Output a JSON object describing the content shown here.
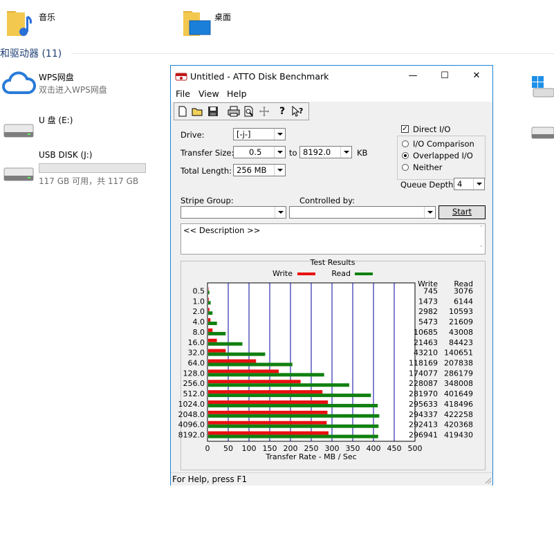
{
  "explorer": {
    "folders": [
      {
        "label": "音乐",
        "icon": "music-folder-icon"
      },
      {
        "label": "桌面",
        "icon": "desktop-folder-icon"
      }
    ],
    "section_title": "和驱动器 (11)",
    "drives": [
      {
        "name": "WPS网盘",
        "sub": "双击进入WPS网盘",
        "icon": "wps-cloud-icon"
      },
      {
        "name": "U 盘 (E:)",
        "sub": "",
        "icon": "usb-drive-icon"
      },
      {
        "name": "USB DISK (J:)",
        "sub": "117 GB 可用，共 117 GB",
        "icon": "usb-drive-icon",
        "used_fraction": 0.0
      }
    ]
  },
  "window": {
    "title": "Untitled - ATTO Disk Benchmark",
    "controls": {
      "minimize": "—",
      "maximize": "☐",
      "close": "✕"
    },
    "menu": [
      "File",
      "View",
      "Help"
    ],
    "toolbar_icons": [
      "new-icon",
      "open-icon",
      "save-icon",
      "print-icon",
      "print-preview-icon",
      "move-icon",
      "help-icon",
      "context-help-icon"
    ],
    "status": "For Help, press F1"
  },
  "form": {
    "drive_label": "Drive:",
    "drive_value": "[-j-]",
    "transfer_size_label": "Transfer Size:",
    "transfer_from": "0.5",
    "to_label": "to",
    "transfer_to": "8192.0",
    "kb_label": "KB",
    "total_length_label": "Total Length:",
    "total_length_value": "256 MB",
    "direct_io_label": "Direct I/O",
    "direct_io_checked": true,
    "io_options": [
      {
        "label": "I/O Comparison",
        "selected": false
      },
      {
        "label": "Overlapped I/O",
        "selected": true
      },
      {
        "label": "Neither",
        "selected": false
      }
    ],
    "queue_depth_label": "Queue Depth:",
    "queue_depth_value": "4",
    "stripe_group_label": "Stripe Group:",
    "controlled_by_label": "Controlled by:",
    "start_label": "Start",
    "description": "<< Description >>"
  },
  "chart_data": {
    "type": "bar",
    "title": "Test Results",
    "categories": [
      "0.5",
      "1.0",
      "2.0",
      "4.0",
      "8.0",
      "16.0",
      "32.0",
      "64.0",
      "128.0",
      "256.0",
      "512.0",
      "1024.0",
      "2048.0",
      "4096.0",
      "8192.0"
    ],
    "series": [
      {
        "name": "Write",
        "color": "#e81010",
        "values": [
          745,
          1473,
          2982,
          5473,
          10685,
          21463,
          43210,
          118169,
          174077,
          228087,
          281970,
          295633,
          294337,
          292413,
          296941
        ]
      },
      {
        "name": "Read",
        "color": "#108010",
        "values": [
          3076,
          6144,
          10593,
          21609,
          43008,
          84423,
          140651,
          207838,
          286179,
          348008,
          401649,
          418496,
          422258,
          420368,
          419430
        ]
      }
    ],
    "write_header": "Write",
    "read_header": "Read",
    "xlabel": "Transfer Rate - MB / Sec",
    "xlim": [
      0,
      500
    ],
    "xticks": [
      "0",
      "50",
      "100",
      "150",
      "200",
      "250",
      "300",
      "350",
      "400",
      "450",
      "500"
    ],
    "orientation": "horizontal",
    "grid": true,
    "legend_position": "top"
  }
}
